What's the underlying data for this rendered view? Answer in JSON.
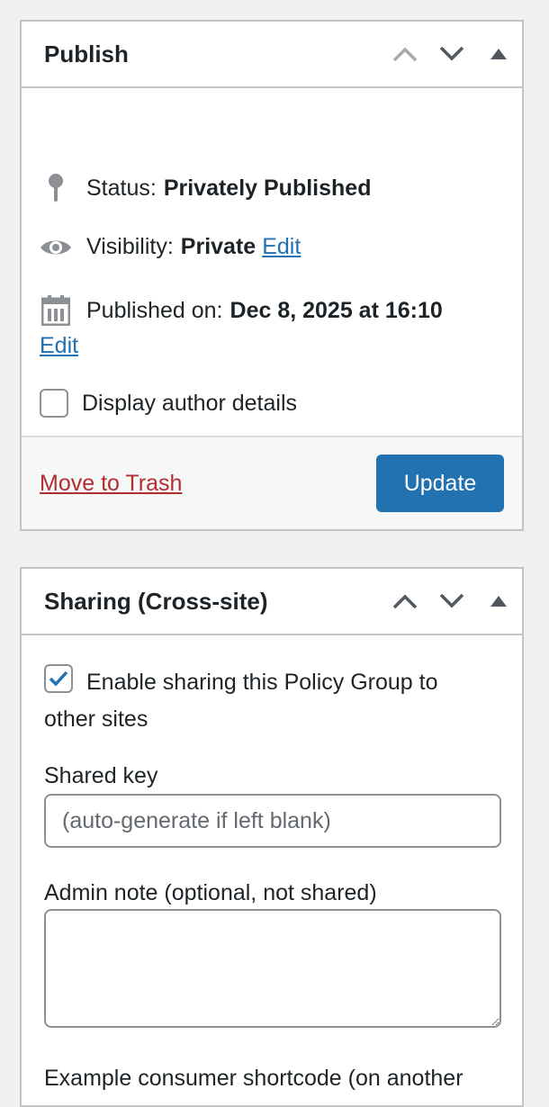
{
  "publish": {
    "title": "Publish",
    "status_label": "Status:",
    "status_value": "Privately Published",
    "visibility_label": "Visibility:",
    "visibility_value": "Private",
    "visibility_edit": "Edit",
    "published_label": "Published on:",
    "published_value": "Dec 8, 2025 at 16:10",
    "published_edit": "Edit",
    "author_details_label": "Display author details",
    "author_details_checked": false,
    "trash_label": "Move to Trash",
    "update_label": "Update"
  },
  "sharing": {
    "title": "Sharing (Cross-site)",
    "enable_label": "Enable sharing this Policy Group to other sites",
    "enable_checked": true,
    "shared_key_label": "Shared key",
    "shared_key_placeholder": "(auto-generate if left blank)",
    "shared_key_value": "",
    "admin_note_label": "Admin note (optional, not shared)",
    "admin_note_value": "",
    "shortcode_label": "Example consumer shortcode (on another"
  },
  "colors": {
    "accent": "#2271b1",
    "danger": "#b32d2e",
    "border": "#c3c4c7",
    "background": "#f0f0f1"
  },
  "icons": {
    "move_up": "chevron-up-icon",
    "move_down": "chevron-down-icon",
    "toggle": "triangle-up-icon",
    "status": "pin-icon",
    "visibility": "eye-icon",
    "published": "calendar-icon",
    "check": "checkmark-icon"
  }
}
